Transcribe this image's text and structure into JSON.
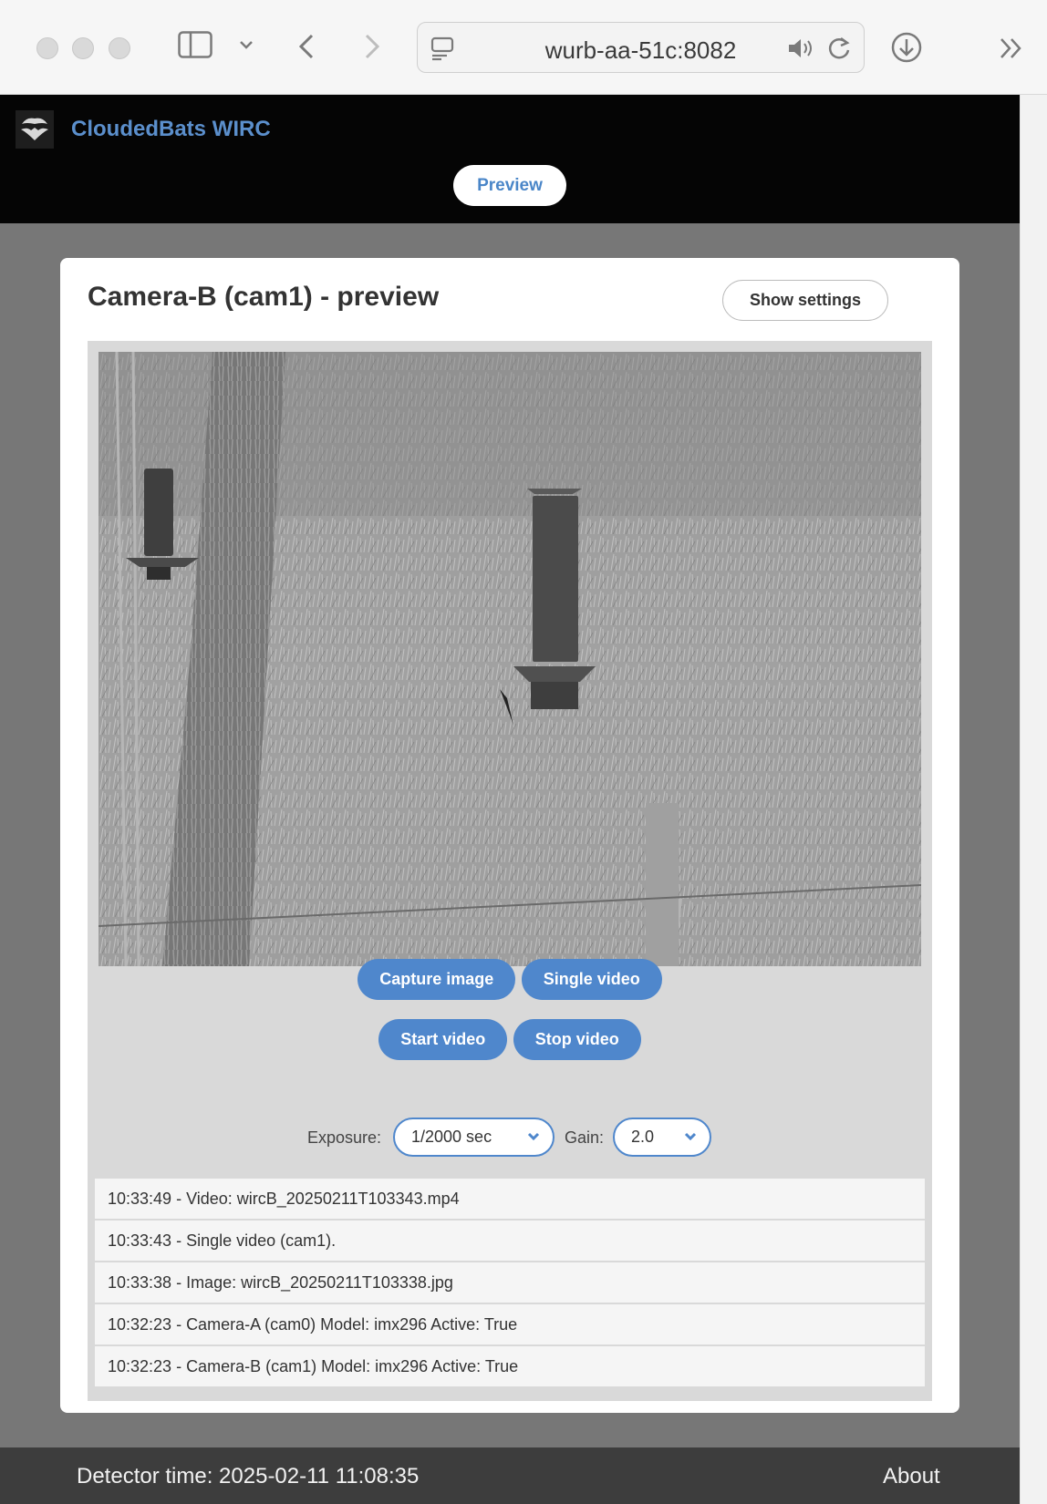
{
  "browser": {
    "url": "wurb-aa-51c:8082"
  },
  "header": {
    "app_title": "CloudedBats WIRC",
    "nav_preview": "Preview"
  },
  "card": {
    "title": "Camera-B (cam1) - preview",
    "show_settings": "Show settings"
  },
  "buttons": {
    "capture_image": "Capture image",
    "single_video": "Single video",
    "start_video": "Start video",
    "stop_video": "Stop video"
  },
  "controls": {
    "exposure_label": "Exposure:",
    "exposure_value": "1/2000 sec",
    "gain_label": "Gain:",
    "gain_value": "2.0"
  },
  "log": [
    "10:33:49 - Video: wircB_20250211T103343.mp4",
    "10:33:43 - Single video (cam1).",
    "10:33:38 - Image: wircB_20250211T103338.jpg",
    "10:32:23 - Camera-A (cam0) Model: imx296 Active: True",
    "10:32:23 - Camera-B (cam1) Model: imx296 Active: True"
  ],
  "footer": {
    "detector_time": "Detector time: 2025-02-11 11:08:35",
    "about": "About"
  },
  "colors": {
    "accent": "#4f87cc",
    "header_bg": "#050505",
    "page_bg": "#777777",
    "footer_bg": "#3d3d3d"
  }
}
